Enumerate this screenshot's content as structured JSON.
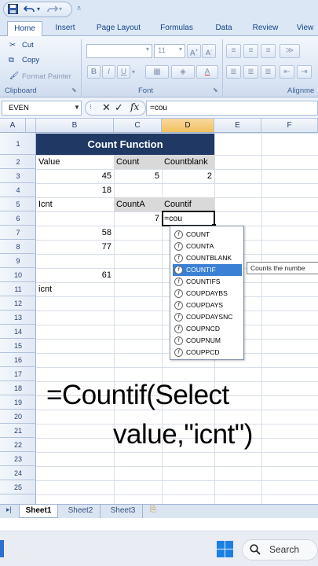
{
  "quick_access": {
    "save_icon": "save-icon",
    "undo_icon": "undo-icon",
    "redo_icon": "redo-icon",
    "customize_icon": "customize-icon"
  },
  "ribbon_tabs": [
    "Home",
    "Insert",
    "Page Layout",
    "Formulas",
    "Data",
    "Review",
    "View"
  ],
  "ribbon": {
    "clipboard": {
      "cut": "Cut",
      "copy": "Copy",
      "format_painter": "Format Painter",
      "group_label": "Clipboard"
    },
    "font": {
      "font_size": "11",
      "bold": "B",
      "italic": "I",
      "underline": "U",
      "group_label": "Font"
    },
    "alignment": {
      "group_label": "Alignme"
    }
  },
  "formula_bar": {
    "name_box": "EVEN",
    "fx": "fx",
    "formula": "=cou"
  },
  "columns": [
    "A",
    "B",
    "C",
    "D",
    "E",
    "F"
  ],
  "rows": [
    "1",
    "2",
    "3",
    "4",
    "5",
    "6",
    "7",
    "8",
    "9",
    "10",
    "11",
    "12",
    "13",
    "14",
    "15",
    "16",
    "17",
    "18",
    "19",
    "20",
    "21",
    "22",
    "23",
    "24",
    "25",
    "26"
  ],
  "cells": {
    "title": "Count Function",
    "b_value": "Value",
    "c_count": "Count",
    "d_countblank": "Countblank",
    "b_45": "45",
    "c_5": "5",
    "d_2": "2",
    "b_18": "18",
    "b_icnt": "Icnt",
    "c_counta": "CountA",
    "d_countif": "Countif",
    "c_7": "7",
    "d_edit": "=cou",
    "b_58": "58",
    "b_77": "77",
    "b_61": "61",
    "b_icnt2": "icnt"
  },
  "autocomplete": {
    "items": [
      "COUNT",
      "COUNTA",
      "COUNTBLANK",
      "COUNTIF",
      "COUNTIFS",
      "COUPDAYBS",
      "COUPDAYS",
      "COUPDAYSNC",
      "COUPNCD",
      "COUPNUM",
      "COUPPCD"
    ],
    "selected": "COUNTIF",
    "tooltip": "Counts the numbe"
  },
  "caption": {
    "line1": "=Countif(Select",
    "line2": "value,\"icnt\")"
  },
  "sheets": [
    "Sheet1",
    "Sheet2",
    "Sheet3"
  ],
  "taskbar": {
    "search": "Search"
  },
  "colors": {
    "title_fill": "#1f3864",
    "gray_fill": "#d9d9d9",
    "selected_item": "#3a80d4"
  }
}
